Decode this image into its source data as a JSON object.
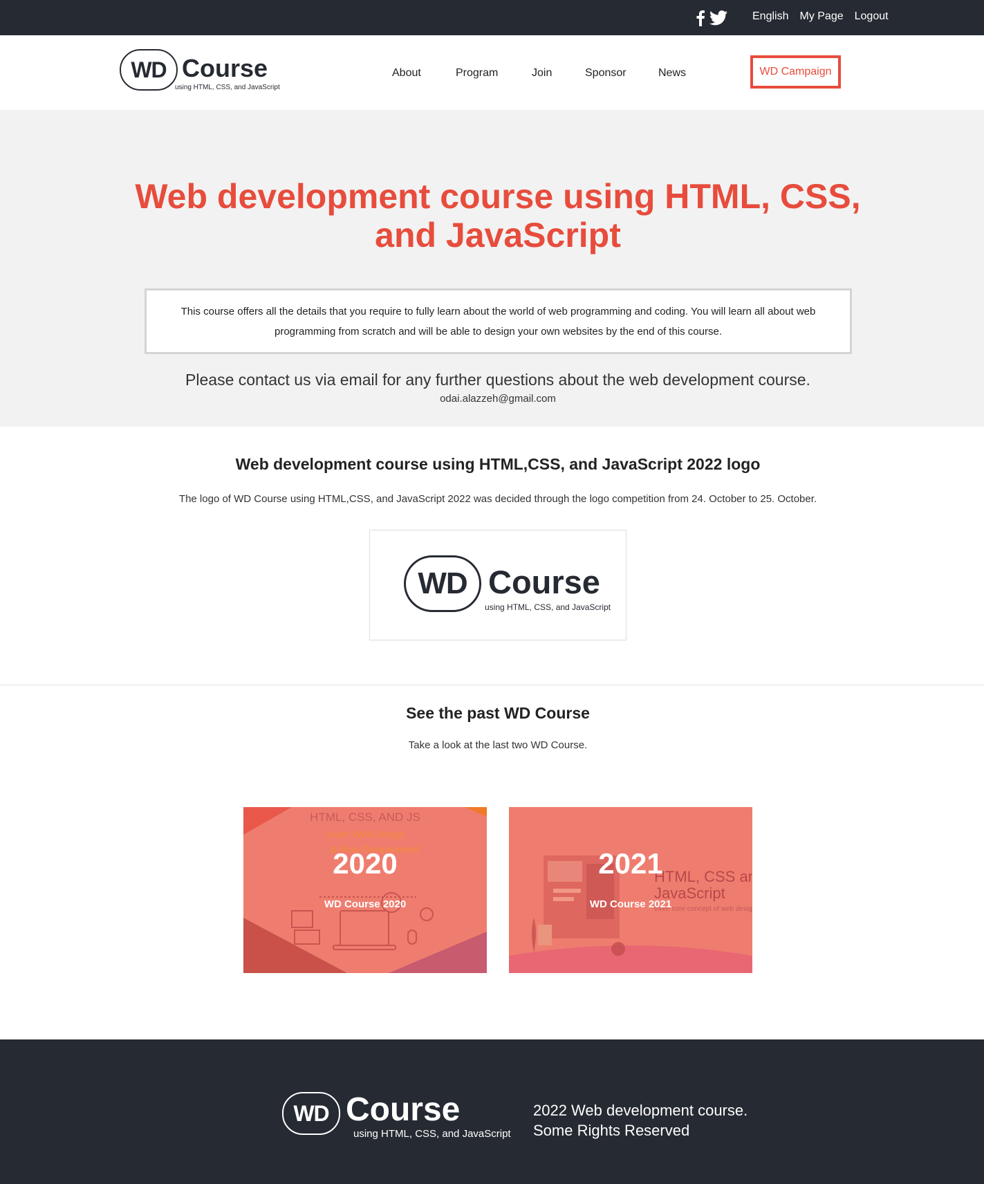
{
  "topbar": {
    "social": [
      "facebook-icon",
      "twitter-icon"
    ],
    "links": [
      "English",
      "My Page",
      "Logout"
    ]
  },
  "header": {
    "logo": {
      "mark": "WD",
      "word": "Course",
      "tagline": "using HTML, CSS, and JavaScript"
    },
    "nav": [
      "About",
      "Program",
      "Join",
      "Sponsor",
      "News"
    ],
    "campaign": "WD Campaign"
  },
  "hero": {
    "title_line1": "Web development course using HTML, CSS,",
    "title_line2": "and JavaScript",
    "description": "This course offers all the details that you require to fully learn about the world of web programming and coding. You will learn all about web programming from scratch and will be able to design your own websites by the end of this course.",
    "contact": "Please contact us via email for any further questions about the web development course.",
    "email": "odai.alazzeh@gmail.com"
  },
  "logo_section": {
    "title": "Web development course using HTML,CSS, and JavaScript 2022 logo",
    "text": "The logo of WD Course using HTML,CSS, and JavaScript 2022 was decided through the logo competition from 24. October to 25. October.",
    "logo": {
      "mark": "WD",
      "word": "Course",
      "tagline": "using HTML, CSS, and JavaScript"
    }
  },
  "past": {
    "title": "See the past WD Course",
    "text": "Take a look at the last two WD Course.",
    "cards": [
      {
        "year": "2020",
        "name": "WD Course 2020",
        "art_lines": [
          "HTML, CSS, AND JS",
          "Learn Web Design",
          "& Web Development"
        ]
      },
      {
        "year": "2021",
        "name": "WD Course 2021",
        "art_lines": [
          "HTML, CSS and",
          "JavaScript",
          "three core concept of web design"
        ]
      }
    ]
  },
  "footer": {
    "logo": {
      "mark": "WD",
      "word": "Course",
      "tagline": "using HTML, CSS, and JavaScript"
    },
    "rights_line1": "2022 Web development course.",
    "rights_line2": "Some Rights Reserved"
  },
  "colors": {
    "accent": "#e74c3c",
    "dark": "#262a32",
    "hero_bg": "#f2f2f2",
    "card_bg": "#ef7d6f"
  }
}
